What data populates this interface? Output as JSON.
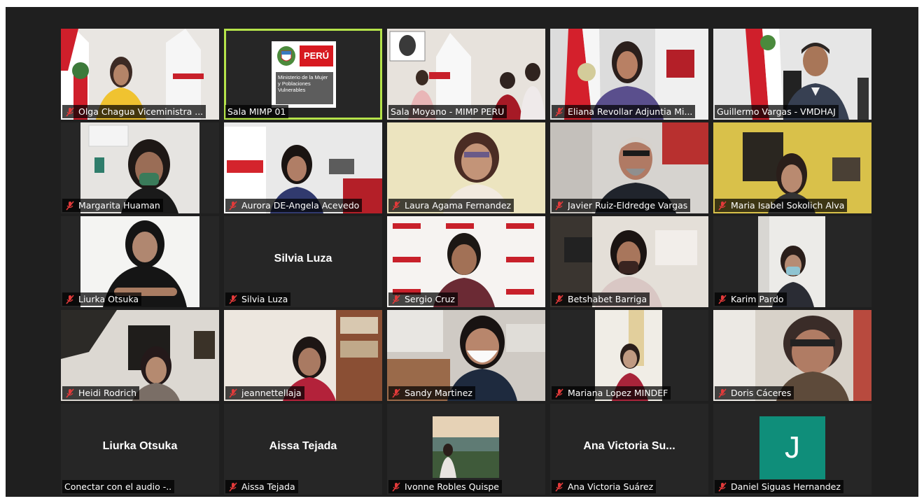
{
  "meeting": {
    "participants": [
      {
        "name": "Olga Chagua Viceministra ...",
        "muted": true
      },
      {
        "name": "Sala MIMP 01",
        "muted": false,
        "active_speaker": true
      },
      {
        "name": "Sala Moyano - MIMP PERU",
        "muted": false
      },
      {
        "name": "Eliana Revollar Adjuntia Mi...",
        "muted": true
      },
      {
        "name": "Guillermo Vargas - VMDHAJ",
        "muted": false
      },
      {
        "name": "Margarita Huaman",
        "muted": true
      },
      {
        "name": "Aurora DE-Angela Acevedo",
        "muted": true
      },
      {
        "name": "Laura Agama Fernandez",
        "muted": true
      },
      {
        "name": "Javier Ruiz-Eldredge Vargas",
        "muted": true
      },
      {
        "name": "Maria Isabel Sokolich Alva",
        "muted": true
      },
      {
        "name": "Liurka Otsuka",
        "muted": true
      },
      {
        "name": "Silvia Luza",
        "muted": true,
        "video_off_label": "Silvia Luza"
      },
      {
        "name": "Sergio Cruz",
        "muted": true
      },
      {
        "name": "Betshabet Barriga",
        "muted": true
      },
      {
        "name": "Karim Pardo",
        "muted": true
      },
      {
        "name": "Heidi Rodrich",
        "muted": true
      },
      {
        "name": "jeannettellaja",
        "muted": true
      },
      {
        "name": "Sandy Martinez",
        "muted": true
      },
      {
        "name": "Mariana Lopez MINDEF",
        "muted": true
      },
      {
        "name": "Doris Cáceres",
        "muted": true
      },
      {
        "name": "Conectar con el audio -..",
        "muted": false,
        "video_off_label": "Liurka Otsuka"
      },
      {
        "name": "Aissa Tejada",
        "muted": true,
        "video_off_label": "Aissa Tejada"
      },
      {
        "name": "Ivonne Robles Quispe",
        "muted": true
      },
      {
        "name": "Ana Victoria Suárez",
        "muted": true,
        "video_off_label": "Ana Victoria Su..."
      },
      {
        "name": "Daniel Siguas Hernandez",
        "muted": true,
        "avatar_letter": "J"
      }
    ]
  },
  "logo": {
    "country": "PERÚ",
    "ministry": "Ministerio de la Mujer y Poblaciones Vulnerables"
  },
  "colors": {
    "background": "#1f1f1f",
    "tile": "#262626",
    "active_border": "#b5e34a",
    "muted_icon": "#e23a3a",
    "avatar": "#0f8e7a"
  }
}
